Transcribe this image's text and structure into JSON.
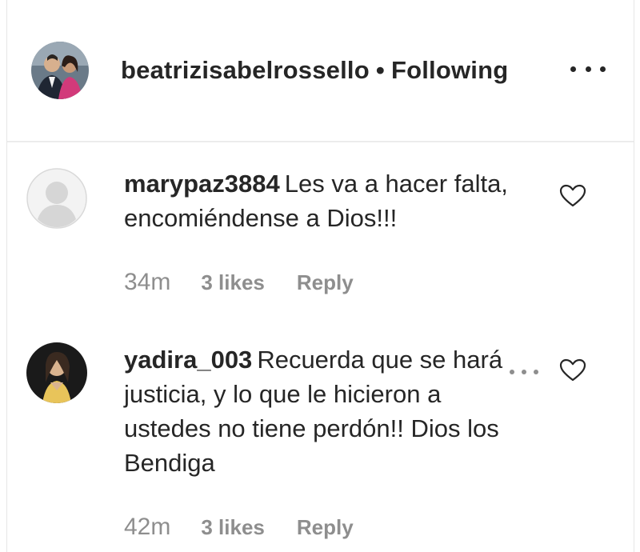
{
  "header": {
    "username": "beatrizisabelrossello",
    "separator": "•",
    "follow_status": "Following",
    "more_icon": "more-horizontal-icon"
  },
  "comments": [
    {
      "username": "marypaz3884",
      "text": "Les va a hacer falta, encomiéndense a Dios!!!",
      "time": "34m",
      "likes": "3 likes",
      "reply": "Reply",
      "avatar_icon": "default-avatar-icon",
      "like_icon": "heart-outline-icon"
    },
    {
      "username": "yadira_003",
      "text": "Recuerda que se hará justicia, y lo que le hicieron a ustedes no tiene perdón!! Dios los Bendiga",
      "time": "42m",
      "likes": "3 likes",
      "reply": "Reply",
      "avatar_icon": "user-photo-avatar",
      "like_icon": "heart-outline-icon"
    }
  ],
  "colors": {
    "text_primary": "#262626",
    "text_secondary": "#8e8e8e",
    "border": "#ececec"
  }
}
